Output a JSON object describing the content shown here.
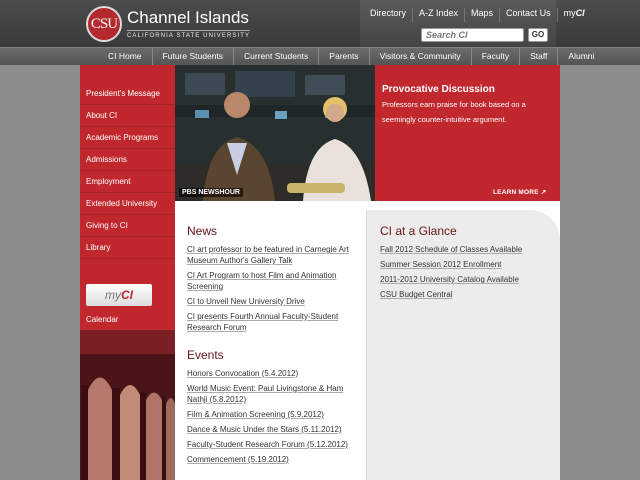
{
  "header": {
    "logo_mark": "CSU",
    "logo_name": "Channel Islands",
    "logo_sub": "CALIFORNIA STATE UNIVERSITY",
    "util_links": [
      "Directory",
      "A-Z Index",
      "Maps",
      "Contact Us"
    ],
    "my_link_prefix": "my",
    "my_link_suffix": "CI",
    "search_placeholder": "Search CI",
    "go_label": "GO"
  },
  "nav": {
    "items": [
      "CI Home",
      "Future Students",
      "Current Students",
      "Parents",
      "Visitors & Community",
      "Faculty",
      "Staff",
      "Alumni"
    ]
  },
  "sidebar": {
    "items": [
      "President's Message",
      "About CI",
      "Academic Programs",
      "Admissions",
      "Employment",
      "Extended University",
      "Giving to CI",
      "Library"
    ],
    "my_button_prefix": "my",
    "my_button_suffix": "CI",
    "calendar_label": "Calendar"
  },
  "hero": {
    "image_caption": "PBS NEWSHOUR",
    "title": "Provocative Discussion",
    "text": "Professors earn praise for book based on a seemingly counter-intuitive argument.",
    "learn_more": "LEARN MORE ↗"
  },
  "news": {
    "title": "News",
    "items": [
      "CI art professor to be featured in Carnegie Art Museum Author's Gallery Talk",
      "CI Art Program to host Film and Animation Screening",
      "CI to Unveil New University Drive",
      "CI presents Fourth Annual Faculty-Student Research Forum"
    ]
  },
  "events": {
    "title": "Events",
    "items": [
      "Honors Convocation (5.4.2012)",
      "World Music Event: Paul Livingstone & Ham Nathji (5.8.2012)",
      "Film & Animation Screening (5.9.2012)",
      "Dance & Music Under the Stars (5.11.2012)",
      "Faculty-Student Research Forum (5.12.2012)",
      "Commencement (5.19.2012)"
    ]
  },
  "glance": {
    "title": "CI at a Glance",
    "items": [
      "Fall 2012 Schedule of Classes Available",
      "Summer Session 2012 Enrollment",
      "2011-2012 University Catalog Available",
      "CSU Budget Central"
    ]
  },
  "colors": {
    "brand_red": "#c1282e",
    "dark_red_text": "#6b1418",
    "header_gray": "#4c4c4c"
  }
}
